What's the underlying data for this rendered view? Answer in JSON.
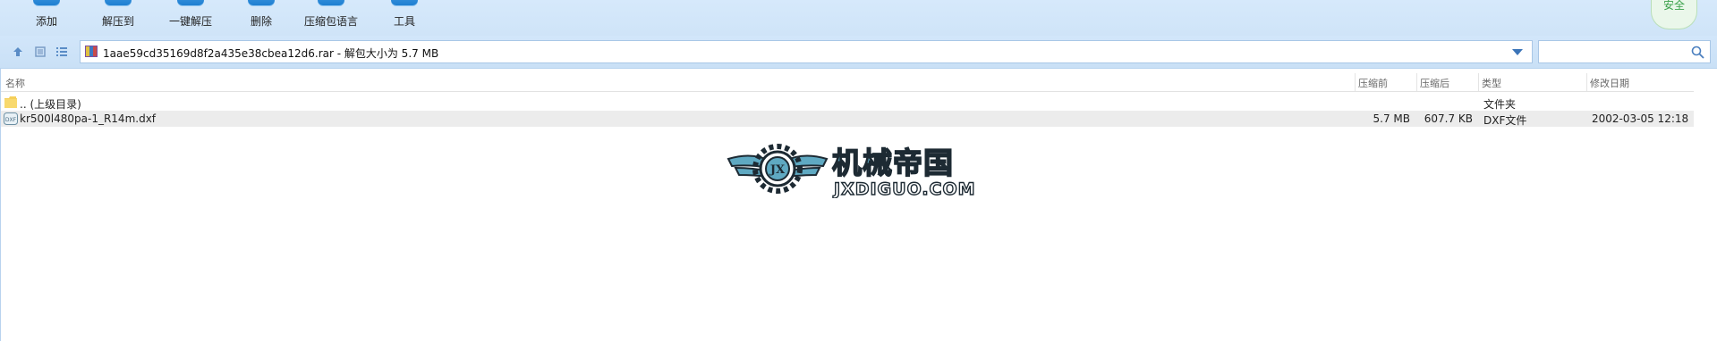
{
  "toolbar": {
    "buttons": [
      {
        "label": "添加",
        "icon": "add-icon"
      },
      {
        "label": "解压到",
        "icon": "extract-to-icon"
      },
      {
        "label": "一键解压",
        "icon": "one-click-extract-icon"
      },
      {
        "label": "删除",
        "icon": "delete-icon"
      },
      {
        "label": "压缩包语言",
        "icon": "archive-language-icon"
      },
      {
        "label": "工具",
        "icon": "tools-icon"
      }
    ],
    "badge": "安全"
  },
  "address": {
    "path": "1aae59cd35169d8f2a435e38cbea12d6.rar - 解包大小为 5.7 MB",
    "search_placeholder": ""
  },
  "columns": {
    "name": "名称",
    "packed": "压缩前",
    "unpacked": "压缩后",
    "type": "类型",
    "modified": "修改日期"
  },
  "rows": [
    {
      "name": ".. (上级目录)",
      "packed": "",
      "unpacked": "",
      "type": "文件夹",
      "modified": "",
      "icon": "folder-icon"
    },
    {
      "name": "kr500l480pa-1_R14m.dxf",
      "packed": "5.7 MB",
      "unpacked": "607.7 KB",
      "type": "DXF文件",
      "modified": "2002-03-05 12:18",
      "icon": "dxf-file-icon"
    }
  ],
  "watermark": {
    "title": "机械帝国",
    "subtitle": "JXDIGUO.COM",
    "emblem_text": "JX",
    "colors": {
      "accent": "#5fa9c2",
      "dark": "#1d2a33"
    }
  },
  "colors": {
    "toolbar_bg": "#d6e9fb",
    "icon_blue": "#1f7fd1",
    "badge_green": "#3aa04a",
    "selected_row": "#ececec"
  }
}
